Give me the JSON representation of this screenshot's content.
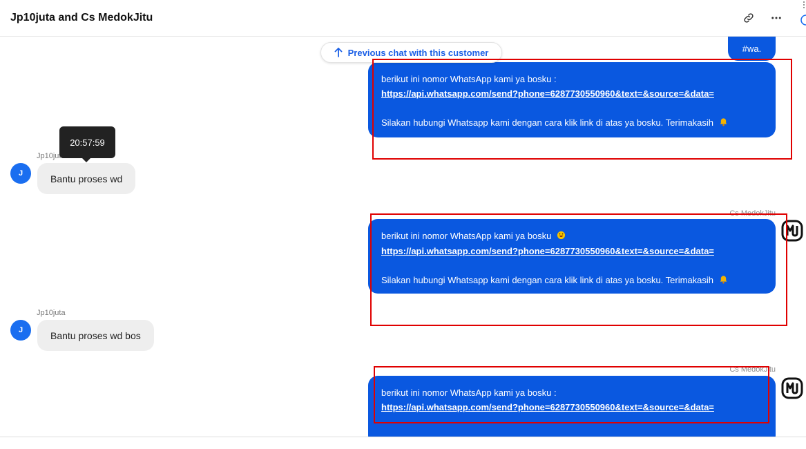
{
  "header": {
    "title": "Jp10juta and Cs MedokJitu",
    "icons": [
      "link-icon",
      "more-icon",
      "info-icon"
    ]
  },
  "chat": {
    "previous_chat_label": "Previous chat with this customer",
    "wa_text": "#wa.",
    "tooltip_time": "20:57:59",
    "agent_messages": [
      {
        "line1": "berikut ini nomor WhatsApp kami ya bosku :",
        "link": "https://api.whatsapp.com/send?phone=6287730550960&text=&source=&data=",
        "line3": "Silakan hubungi Whatsapp kami dengan cara klik link di atas ya bosku. Terimakasih"
      },
      {
        "sender": "Cs MedokJitu",
        "line1": "berikut ini nomor WhatsApp kami ya bosku",
        "link": "https://api.whatsapp.com/send?phone=6287730550960&text=&source=&data=",
        "line3": "Silakan hubungi Whatsapp kami dengan cara klik link di atas ya bosku. Terimakasih"
      },
      {
        "sender": "Cs MedokJitu",
        "line1": "berikut ini nomor WhatsApp kami ya bosku :",
        "link": "https://api.whatsapp.com/send?phone=6287730550960&text=&source=&data="
      }
    ],
    "customer_messages": [
      {
        "name": "Jp10juta",
        "avatar_initial": "J",
        "text": "Bantu proses wd"
      },
      {
        "name": "Jp10juta",
        "avatar_initial": "J",
        "text": "Bantu proses wd bos"
      }
    ]
  },
  "colors": {
    "agent_bubble": "#0a58e0",
    "customer_bubble": "#eeeeee",
    "link_blue": "#1a5fe6",
    "highlight_red": "#e00000",
    "avatar_blue": "#1a6ef0"
  }
}
